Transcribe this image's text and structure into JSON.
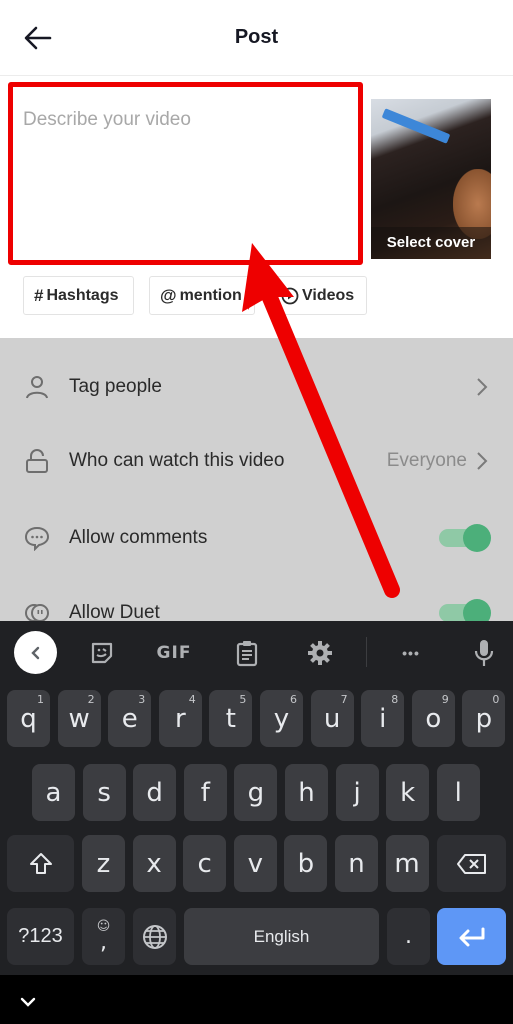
{
  "header": {
    "title": "Post",
    "back_icon": "arrow-left-icon"
  },
  "compose": {
    "description_placeholder": "Describe your video",
    "description_value": "",
    "cover_label": "Select cover",
    "highlight_color": "#ee0000"
  },
  "chips": [
    {
      "icon": "#",
      "label": "Hashtags"
    },
    {
      "icon": "@",
      "label": "mention"
    },
    {
      "icon": "▶",
      "label": "Videos"
    }
  ],
  "settings": {
    "rows": [
      {
        "label": "Tag people",
        "icon": "person-icon",
        "value": "",
        "control": "chevron"
      },
      {
        "label": "Who can watch this video",
        "icon": "unlock-icon",
        "value": "Everyone",
        "control": "chevron"
      },
      {
        "label": "Allow comments",
        "icon": "comment-icon",
        "value": "",
        "control": "toggle",
        "on": true
      },
      {
        "label": "Allow Duet",
        "icon": "duet-icon",
        "value": "",
        "control": "toggle",
        "on": true
      }
    ],
    "toggle_color": "#4caf7a"
  },
  "keyboard": {
    "toolbar": [
      "collapse",
      "sticker",
      "GIF",
      "clipboard",
      "settings",
      "more",
      "mic"
    ],
    "gif_label": "GIF",
    "more_label": "•••",
    "row1": [
      {
        "k": "q",
        "h": "1"
      },
      {
        "k": "w",
        "h": "2"
      },
      {
        "k": "e",
        "h": "3"
      },
      {
        "k": "r",
        "h": "4"
      },
      {
        "k": "t",
        "h": "5"
      },
      {
        "k": "y",
        "h": "6"
      },
      {
        "k": "u",
        "h": "7"
      },
      {
        "k": "i",
        "h": "8"
      },
      {
        "k": "o",
        "h": "9"
      },
      {
        "k": "p",
        "h": "0"
      }
    ],
    "row2": [
      "a",
      "s",
      "d",
      "f",
      "g",
      "h",
      "j",
      "k",
      "l"
    ],
    "row3": [
      "z",
      "x",
      "c",
      "v",
      "b",
      "n",
      "m"
    ],
    "symbols_label": "?123",
    "comma_label": ",",
    "emoji_hint": "☺",
    "space_label": "English",
    "period_label": ".",
    "enter_color": "#5e97f6"
  },
  "annotation": {
    "arrow_color": "#ee0000",
    "target": "description-input"
  }
}
